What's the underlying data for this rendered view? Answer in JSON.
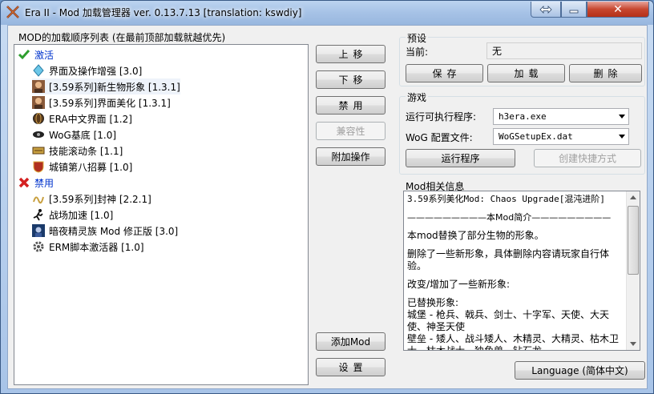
{
  "window": {
    "title": "Era II - Mod 加载管理器 ver. 0.13.7.13 [translation: kswdiy]",
    "close_symbol": "✕"
  },
  "mod_list": {
    "heading": "MOD的加载顺序列表 (在最前顶部加载就越优先)",
    "active_group": "激活",
    "active_items": [
      "界面及操作增强 [3.0]",
      "[3.59系列]新生物形象 [1.3.1]",
      "[3.59系列]界面美化 [1.3.1]",
      "ERA中文界面 [1.2]",
      "WoG基底 [1.0]",
      "技能滚动条 [1.1]",
      "城镇第八招募 [1.0]"
    ],
    "disabled_group": "禁用",
    "disabled_items": [
      "[3.59系列]封神 [2.2.1]",
      "战场加速 [1.0]",
      "暗夜精灵族 Mod 修正版 [3.0]",
      "ERM脚本激活器 [1.0]"
    ]
  },
  "actions": {
    "move_up": "上移",
    "move_down": "下移",
    "disable": "禁用",
    "compat": "兼容性",
    "extra_ops": "附加操作",
    "add_mod": "添加Mod",
    "settings": "设置"
  },
  "preset": {
    "heading": "预设",
    "current_label": "当前:",
    "current_value": "无",
    "save": "保存",
    "load": "加载",
    "delete": "删除"
  },
  "game": {
    "heading": "游戏",
    "exe_label": "运行可执行程序:",
    "exe_value": "h3era.exe",
    "wog_label": "WoG 配置文件:",
    "wog_value": "WoGSetupEx.dat",
    "run": "运行程序",
    "shortcut": "创建快捷方式"
  },
  "info": {
    "heading": "Mod相关信息",
    "lines": [
      "3.59系列美化Mod: Chaos Upgrade[混沌进阶]",
      "—————————本Mod简介—————————",
      "本mod替换了部分生物的形象。",
      "删除了一些新形象，具体删除内容请玩家自行体验。",
      "改变/增加了一些新形象:",
      "已替换形象:",
      "城堡 - 枪兵、戟兵、剑士、十字军、天使、大天使、神圣天使",
      "壁垒 - 矮人、战斗矮人、木精灵、大精灵、枯木卫士、枯木战士、独角兽、钻石龙"
    ]
  },
  "language_button": "Language (简体中文)"
}
